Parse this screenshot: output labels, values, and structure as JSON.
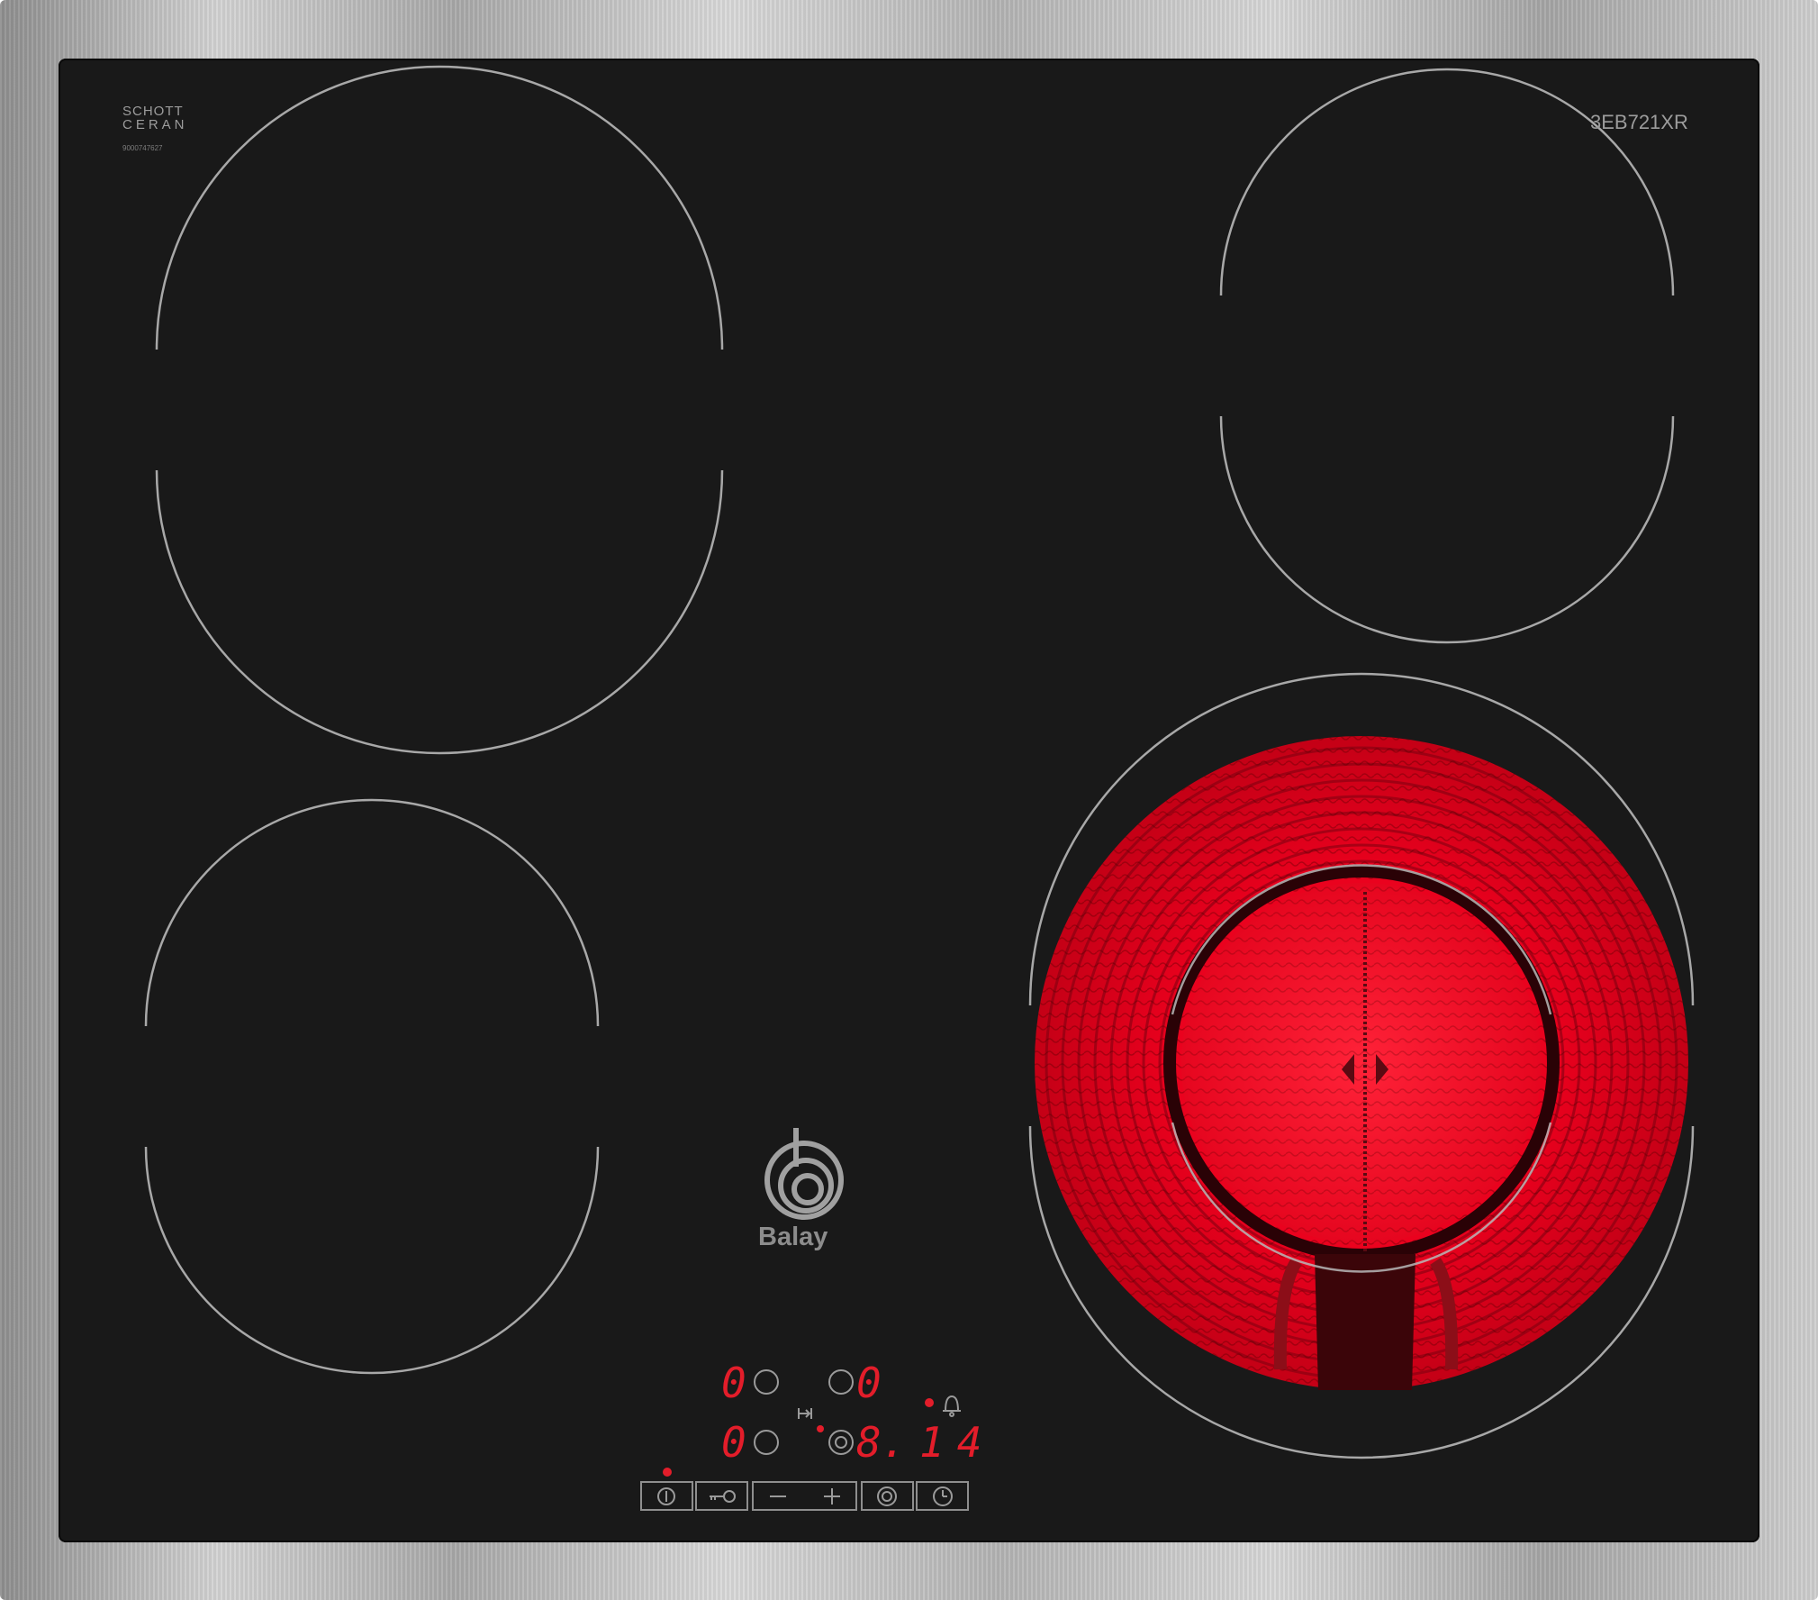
{
  "brand": {
    "glass_brand_line1": "SCHOTT",
    "glass_brand_line2": "CERAN",
    "serial": "9000747627",
    "model": "3EB721XR",
    "manufacturer": "Balay"
  },
  "cooking_zones": [
    {
      "position": "rear-left",
      "state": "off"
    },
    {
      "position": "rear-right",
      "state": "off"
    },
    {
      "position": "front-left",
      "state": "off"
    },
    {
      "position": "front-right",
      "state": "glowing red (dual-circuit, heating)"
    }
  ],
  "display": {
    "rear_left_level": "0",
    "rear_right_level": "0",
    "front_left_level": "0",
    "front_right_level": "8.",
    "timer_value": "14"
  },
  "controls": [
    {
      "name": "power",
      "icon": "power-icon"
    },
    {
      "name": "child-lock",
      "icon": "key-icon"
    },
    {
      "name": "minus",
      "icon": "minus-icon"
    },
    {
      "name": "plus",
      "icon": "plus-icon"
    },
    {
      "name": "dual-zone",
      "icon": "dual-ring-icon"
    },
    {
      "name": "timer",
      "icon": "clock-icon"
    }
  ],
  "colors": {
    "glass": "#191919",
    "frame": "#b8b8b8",
    "ring_outline": "#a8a8a8",
    "heat_glow": "#e3001b",
    "display_red": "#e31d2a"
  }
}
